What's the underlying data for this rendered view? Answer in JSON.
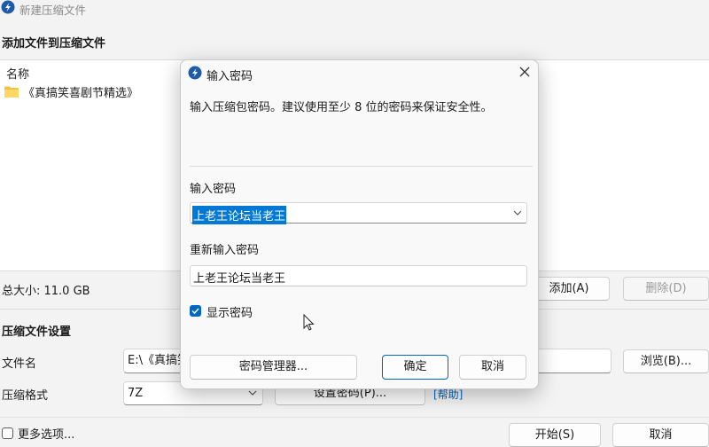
{
  "window": {
    "title": "新建压缩文件"
  },
  "add_section": {
    "heading": "添加文件到压缩文件"
  },
  "file_list": {
    "column_name": "名称",
    "items": [
      {
        "name": "《真搞笑喜剧节精选》"
      }
    ]
  },
  "total_size": "总大小: 11.0 GB",
  "add_button": "添加(A)",
  "delete_button": "删除(D)",
  "settings": {
    "heading": "压缩文件设置",
    "filename_label": "文件名",
    "filename_value": "E:\\《真搞笑",
    "browse_button": "浏览(B)...",
    "format_label": "压缩格式",
    "format_value": "7Z",
    "set_password_button": "设置密码(P)...",
    "help_link": "[帮助]",
    "more_options": "更多选项...",
    "start_button": "开始(S)",
    "cancel_button": "取消"
  },
  "dialog": {
    "title": "输入密码",
    "description": "输入压缩包密码。建议使用至少 8 位的密码来保证安全性。",
    "password_label": "输入密码",
    "password_value": "上老王论坛当老王",
    "confirm_label": "重新输入密码",
    "confirm_value": "上老王论坛当老王",
    "show_password": "显示密码",
    "show_password_checked": true,
    "manager_button": "密码管理器...",
    "ok_button": "确定",
    "cancel_button": "取消"
  },
  "colors": {
    "accent": "#0067c0",
    "selection": "#0078d4"
  }
}
